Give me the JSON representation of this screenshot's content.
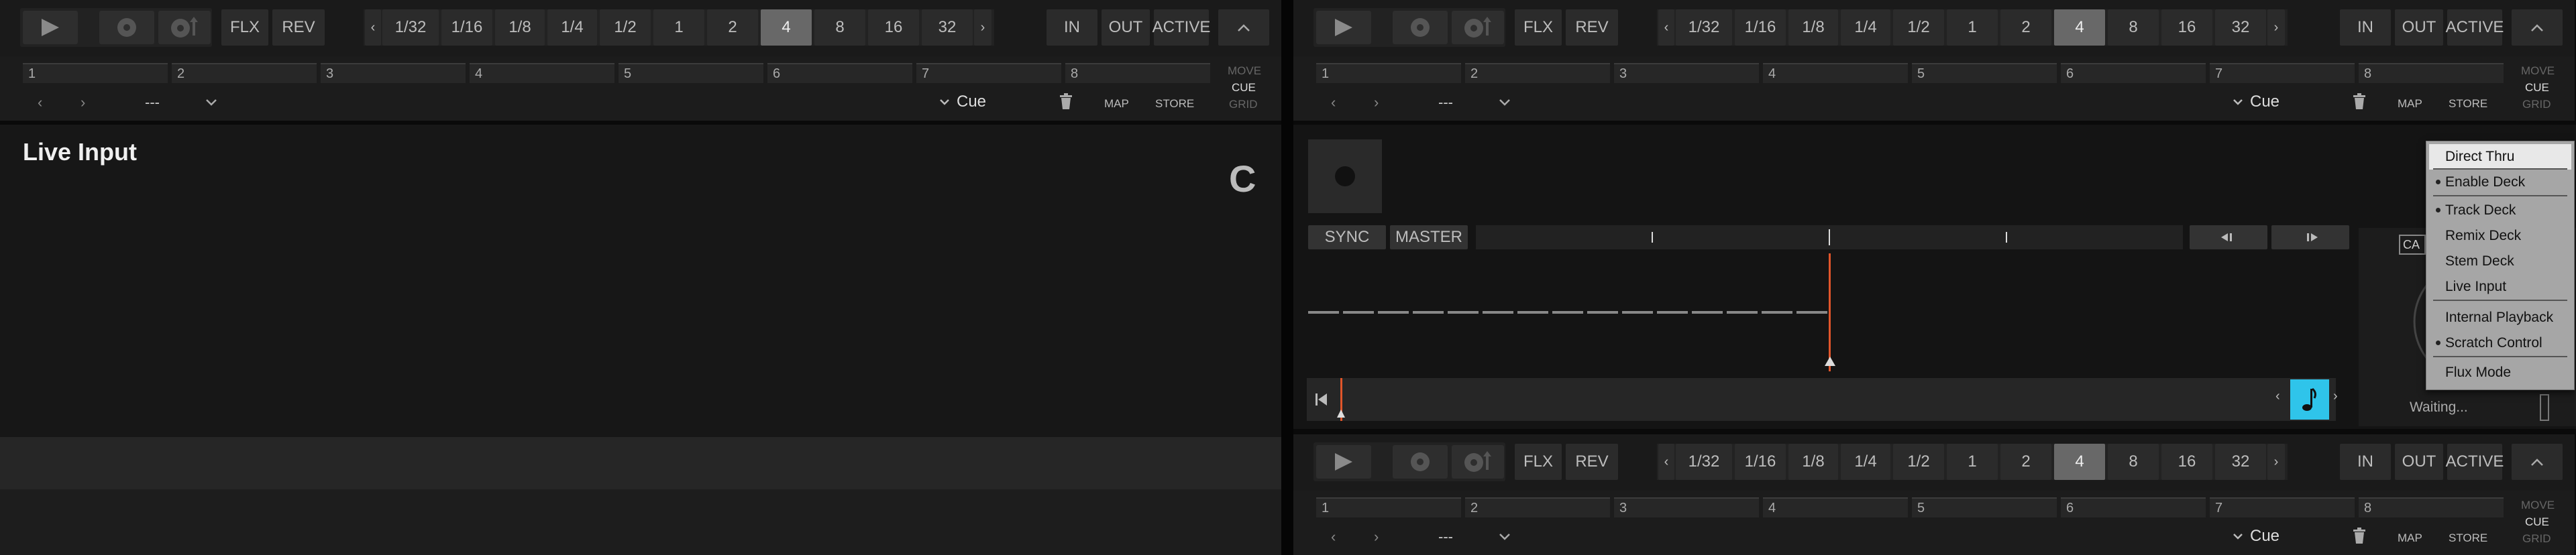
{
  "deck_header": {
    "flux_label": "FLX",
    "reverse_label": "REV",
    "loop_sizes": [
      "1/32",
      "1/16",
      "1/8",
      "1/4",
      "1/2",
      "1",
      "2",
      "4",
      "8",
      "16",
      "32"
    ],
    "selected_loop_size": "4",
    "in_label": "IN",
    "out_label": "OUT",
    "active_label": "ACTIVE",
    "hotcue_slots": [
      "1",
      "2",
      "3",
      "4",
      "5",
      "6",
      "7",
      "8"
    ],
    "move_label": "MOVE",
    "cue_label": "CUE",
    "grid_label": "GRID",
    "hotcue_name": "---",
    "cue_type": "Cue",
    "map_label": "MAP",
    "store_label": "STORE"
  },
  "deck_c": {
    "title": "Live Input",
    "letter": "C"
  },
  "deck_b": {
    "sync_label": "SYNC",
    "master_label": "MASTER",
    "status": "Waiting...",
    "cue_button_partial": "CA",
    "accent_color": "#2fc4ea",
    "playhead_color": "#e0552a"
  },
  "deck_type_menu": {
    "items": [
      {
        "label": "Direct Thru",
        "checked": false,
        "highlighted": true
      },
      {
        "label": "Enable Deck",
        "checked": true,
        "highlighted": false
      },
      {
        "label": "Track Deck",
        "checked": true,
        "highlighted": false
      },
      {
        "label": "Remix Deck",
        "checked": false,
        "highlighted": false
      },
      {
        "label": "Stem Deck",
        "checked": false,
        "highlighted": false
      },
      {
        "label": "Live Input",
        "checked": false,
        "highlighted": false
      },
      {
        "label": "Internal Playback",
        "checked": false,
        "highlighted": false
      },
      {
        "label": "Scratch Control",
        "checked": true,
        "highlighted": false
      },
      {
        "label": "Flux Mode",
        "checked": false,
        "highlighted": false
      }
    ]
  }
}
